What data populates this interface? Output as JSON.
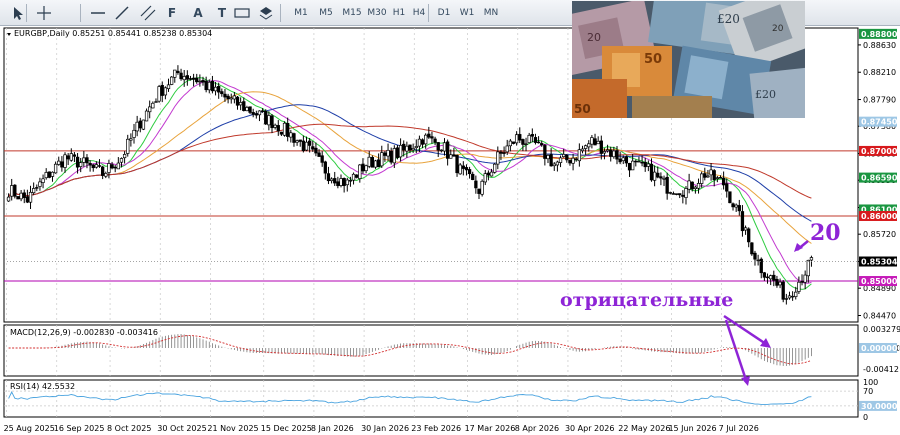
{
  "toolbar": {
    "tools": [
      {
        "name": "cursor-icon"
      },
      {
        "name": "crosshair-icon"
      },
      {
        "name": "horizontal-line-icon"
      },
      {
        "name": "trendline-icon"
      },
      {
        "name": "channel-icon"
      },
      {
        "name": "fibonacci-icon",
        "label": "F"
      },
      {
        "name": "text-icon",
        "label": "A"
      },
      {
        "name": "text-label-icon",
        "label": "T"
      },
      {
        "name": "rectangle-icon"
      },
      {
        "name": "shapes-icon"
      }
    ],
    "timeframes": [
      "M1",
      "M5",
      "M15",
      "M30",
      "H1",
      "H4",
      "D1",
      "W1",
      "MN"
    ]
  },
  "chart_data": {
    "type": "candlestick",
    "symbol_header": "EURGBP,Daily  0.85251 0.85441 0.85238 0.85304",
    "ylim": [
      0.8437,
      0.8889
    ],
    "y_ticks": [
      "0.88630",
      "0.88210",
      "0.87790",
      "0.87380",
      "0.86960",
      "0.86550",
      "0.86130",
      "0.85720",
      "0.85300",
      "0.84890",
      "0.84470"
    ],
    "price_tags": [
      {
        "value": 0.888,
        "label": "0.88800",
        "color": "#1a9641"
      },
      {
        "value": 0.8745,
        "label": "0.87450",
        "color": "#9ec7e5"
      },
      {
        "value": 0.87,
        "label": "0.87000",
        "color": "#d7191c"
      },
      {
        "value": 0.8659,
        "label": "0.86590",
        "color": "#1a9641"
      },
      {
        "value": 0.861,
        "label": "0.86100",
        "color": "#1a9641"
      },
      {
        "value": 0.86,
        "label": "0.86000",
        "color": "#d7191c"
      },
      {
        "value": 0.853,
        "label": "0.85304",
        "color": "#000000"
      },
      {
        "value": 0.85,
        "label": "0.85000",
        "color": "#c51bb8"
      }
    ],
    "hlines": [
      {
        "value": 0.87,
        "color": "#c0392b"
      },
      {
        "value": 0.86,
        "color": "#c0392b"
      },
      {
        "value": 0.85,
        "color": "#b000b0"
      }
    ],
    "x_labels": [
      "25 Aug 2025",
      "16 Sep 2025",
      "8 Oct 2025",
      "30 Oct 2025",
      "21 Nov 2025",
      "15 Dec 2025",
      "8 Jan 2026",
      "30 Jan 2026",
      "23 Feb 2026",
      "17 Mar 2026",
      "8 Apr 2026",
      "30 Apr 2026",
      "22 May 2026",
      "15 Jun 2026",
      "7 Jul 2026"
    ],
    "series_anchor": [
      [
        0,
        0.864
      ],
      [
        6,
        0.8625
      ],
      [
        12,
        0.866
      ],
      [
        18,
        0.869
      ],
      [
        24,
        0.868
      ],
      [
        30,
        0.8665
      ],
      [
        36,
        0.869
      ],
      [
        42,
        0.8745
      ],
      [
        48,
        0.879
      ],
      [
        54,
        0.882
      ],
      [
        60,
        0.881
      ],
      [
        66,
        0.879
      ],
      [
        72,
        0.8775
      ],
      [
        78,
        0.876
      ],
      [
        84,
        0.8745
      ],
      [
        90,
        0.8725
      ],
      [
        96,
        0.87
      ],
      [
        102,
        0.8665
      ],
      [
        108,
        0.865
      ],
      [
        114,
        0.868
      ],
      [
        120,
        0.869
      ],
      [
        126,
        0.87
      ],
      [
        132,
        0.872
      ],
      [
        138,
        0.871
      ],
      [
        144,
        0.867
      ],
      [
        150,
        0.864
      ],
      [
        156,
        0.869
      ],
      [
        162,
        0.872
      ],
      [
        168,
        0.871
      ],
      [
        174,
        0.868
      ],
      [
        180,
        0.869
      ],
      [
        186,
        0.8715
      ],
      [
        192,
        0.8698
      ],
      [
        198,
        0.868
      ],
      [
        204,
        0.867
      ],
      [
        210,
        0.8645
      ],
      [
        216,
        0.864
      ],
      [
        222,
        0.8665
      ],
      [
        228,
        0.865
      ],
      [
        232,
        0.861
      ],
      [
        236,
        0.856
      ],
      [
        240,
        0.852
      ],
      [
        244,
        0.85
      ],
      [
        248,
        0.8475
      ],
      [
        252,
        0.85
      ],
      [
        256,
        0.853
      ]
    ],
    "indicators": [
      {
        "name": "ma20",
        "color": "#2ecc40",
        "period": 10
      },
      {
        "name": "ma50",
        "color": "#c33ad0",
        "period": 16
      },
      {
        "name": "ma100",
        "color": "#e8a33c",
        "period": 35
      },
      {
        "name": "ma150",
        "color": "#1f3fa8",
        "period": 55
      },
      {
        "name": "ma200",
        "color": "#c0392b",
        "period": 85
      }
    ],
    "macd": {
      "label": "MACD(12,26,9) -0.002830 -0.003416",
      "ticks": [
        "0.003279",
        "0.000000",
        "-0.00412"
      ],
      "zero_tag": "0.000000"
    },
    "rsi": {
      "label": "RSI(14) 42.5532",
      "ticks": [
        "100",
        "70",
        "30",
        "0"
      ],
      "tag": "30.0000"
    },
    "annotations": [
      {
        "text": "отрицательные",
        "color": "#8e24d6"
      },
      {
        "text": "20",
        "color": "#8e24d6"
      }
    ]
  }
}
